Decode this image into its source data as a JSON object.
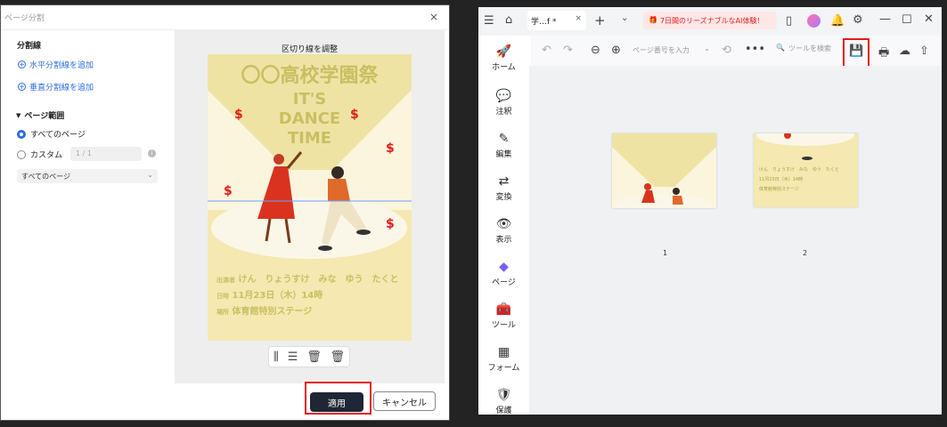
{
  "dialog": {
    "title": "ページ分割",
    "close": "×",
    "split_section": "分割線",
    "add_horizontal": "水平分割線を追加",
    "add_vertical": "垂直分割線を追加",
    "page_range": "ページ範囲",
    "all_pages": "すべてのページ",
    "custom": "カスタム",
    "custom_placeholder": "1 / 1",
    "select_value": "すべてのページ",
    "preview_title": "区切り線を調整",
    "apply": "適用",
    "cancel": "キャンセル"
  },
  "poster": {
    "heading": "〇〇高校学園祭",
    "line1": "IT'S",
    "line2": "DANCE",
    "line3": "TIME",
    "performers_label": "出演者",
    "performers": "けん　りょうすけ　みな　ゆう　たくと",
    "date_label": "日時",
    "date": "11月23日（木）14時",
    "place_label": "場所",
    "place": "体育館特別ステージ"
  },
  "app": {
    "tab": "学…f *",
    "promo": "7日間のリーズナブルなAI体験！",
    "page_input_placeholder": "ページ番号を入力",
    "tool_search_placeholder": "ツールを検索",
    "sidebar": [
      "ホーム",
      "注釈",
      "編集",
      "変換",
      "表示",
      "ページ",
      "ツール",
      "フォーム",
      "保護"
    ],
    "thumbs": [
      {
        "label": "1"
      },
      {
        "label": "2"
      }
    ],
    "thumb2": {
      "performers": "けん　りょうすけ　みな　ゆう　たくと",
      "date": "11月23日（木）14時",
      "place": "体育館特別ステージ"
    }
  },
  "colors": {
    "accent": "#2d6cdf",
    "highlight": "#e21b1b",
    "dark_button": "#1f2635",
    "poster_text": "#c9bf62"
  }
}
